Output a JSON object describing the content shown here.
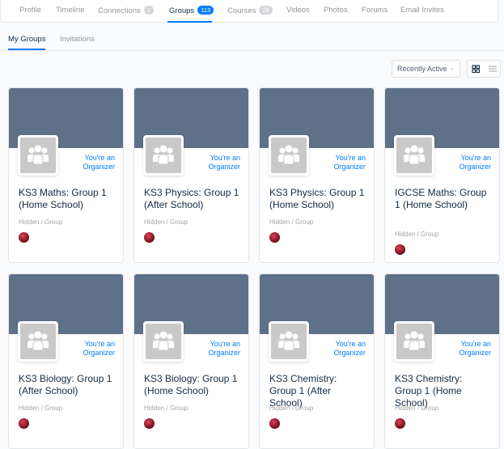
{
  "topnav": {
    "tabs": [
      {
        "label": "Profile"
      },
      {
        "label": "Timeline"
      },
      {
        "label": "Connections",
        "count": "1"
      },
      {
        "label": "Groups",
        "count": "113",
        "active": true
      },
      {
        "label": "Courses",
        "count": "29"
      },
      {
        "label": "Videos"
      },
      {
        "label": "Photos"
      },
      {
        "label": "Forums"
      },
      {
        "label": "Email Invites"
      }
    ]
  },
  "subtabs": {
    "my_groups": "My Groups",
    "invitations": "Invitations"
  },
  "sort": {
    "selected": "Recently Active"
  },
  "colors": {
    "accent": "#007cff",
    "cover": "#5e7189"
  },
  "groups": [
    {
      "name": "KS3 Maths: Group 1 (Home School)",
      "role": "You're an Organizer",
      "meta": "Hidden / Group"
    },
    {
      "name": "KS3 Physics: Group 1 (After School)",
      "role": "You're an Organizer",
      "meta": "Hidden / Group"
    },
    {
      "name": "KS3 Physics: Group 1 (Home School)",
      "role": "You're an Organizer",
      "meta": "Hidden / Group"
    },
    {
      "name": "IGCSE Maths: Group 1 (Home School)",
      "role": "You're an Organizer",
      "meta": "Hidden / Group"
    },
    {
      "name": "KS3 Biology: Group 1 (After School)",
      "role": "You're an Organizer",
      "meta": "Hidden / Group"
    },
    {
      "name": "KS3 Biology: Group 1 (Home School)",
      "role": "You're an Organizer",
      "meta": "Hidden / Group"
    },
    {
      "name": "KS3 Chemistry: Group 1 (After School)",
      "role": "You're an Organizer",
      "meta": "Hidden / Group"
    },
    {
      "name": "KS3 Chemistry: Group 1 (Home School)",
      "role": "You're an Organizer",
      "meta": "Hidden / Group"
    }
  ]
}
